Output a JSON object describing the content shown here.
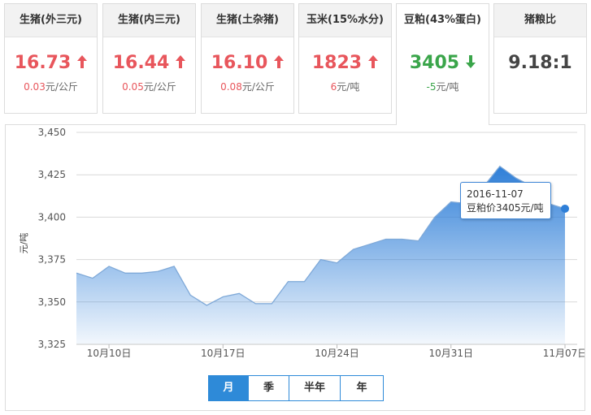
{
  "cards": [
    {
      "title": "生猪(外三元)",
      "price": "16.73",
      "change_value": "0.03",
      "change_unit": "元/公斤",
      "trend": "up"
    },
    {
      "title": "生猪(内三元)",
      "price": "16.44",
      "change_value": "0.05",
      "change_unit": "元/公斤",
      "trend": "up"
    },
    {
      "title": "生猪(土杂猪)",
      "price": "16.10",
      "change_value": "0.08",
      "change_unit": "元/公斤",
      "trend": "up"
    },
    {
      "title": "玉米(15%水分)",
      "price": "1823",
      "change_value": "6",
      "change_unit": "元/吨",
      "trend": "up"
    },
    {
      "title": "豆粕(43%蛋白)",
      "price": "3405",
      "change_value": "-5",
      "change_unit": "元/吨",
      "trend": "down"
    },
    {
      "title": "猪粮比",
      "price": "9.18:1",
      "change_value": "",
      "change_unit": "",
      "trend": "none"
    }
  ],
  "colors": {
    "up": "#e8565c",
    "down": "#3aa54a",
    "accent": "#2e8ad8"
  },
  "tooltip": {
    "date": "2016-11-07",
    "text": "豆粕价3405元/吨"
  },
  "range_buttons": [
    {
      "label": "月",
      "active": true
    },
    {
      "label": "季",
      "active": false
    },
    {
      "label": "半年",
      "active": false
    },
    {
      "label": "年",
      "active": false
    }
  ],
  "chart_data": {
    "type": "area",
    "title": "",
    "xlabel": "",
    "ylabel": "元/吨",
    "ylim": [
      3325,
      3450
    ],
    "yticks": [
      3325,
      3350,
      3375,
      3400,
      3425,
      3450
    ],
    "y_tick_labels": [
      "3,325",
      "3,350",
      "3,375",
      "3,400",
      "3,425",
      "3,450"
    ],
    "x_tick_labels": [
      {
        "label": "10月10日",
        "x": "2016-10-10"
      },
      {
        "label": "10月17日",
        "x": "2016-10-17"
      },
      {
        "label": "10月24日",
        "x": "2016-10-24"
      },
      {
        "label": "10月31日",
        "x": "2016-10-31"
      },
      {
        "label": "11月07日",
        "x": "2016-11-07"
      }
    ],
    "grid": true,
    "series": [
      {
        "name": "豆粕价",
        "x": [
          "2016-10-08",
          "2016-10-09",
          "2016-10-10",
          "2016-10-11",
          "2016-10-12",
          "2016-10-13",
          "2016-10-14",
          "2016-10-15",
          "2016-10-16",
          "2016-10-17",
          "2016-10-18",
          "2016-10-19",
          "2016-10-20",
          "2016-10-21",
          "2016-10-22",
          "2016-10-23",
          "2016-10-24",
          "2016-10-25",
          "2016-10-26",
          "2016-10-27",
          "2016-10-28",
          "2016-10-29",
          "2016-10-30",
          "2016-10-31",
          "2016-11-01",
          "2016-11-02",
          "2016-11-03",
          "2016-11-04",
          "2016-11-05",
          "2016-11-06",
          "2016-11-07"
        ],
        "values": [
          3367,
          3364,
          3371,
          3367,
          3367,
          3368,
          3371,
          3354,
          3348,
          3353,
          3355,
          3349,
          3349,
          3362,
          3362,
          3375,
          3373,
          3381,
          3384,
          3387,
          3387,
          3386,
          3400,
          3409,
          3408,
          3418,
          3430,
          3423,
          3418,
          3408,
          3405
        ]
      }
    ]
  }
}
